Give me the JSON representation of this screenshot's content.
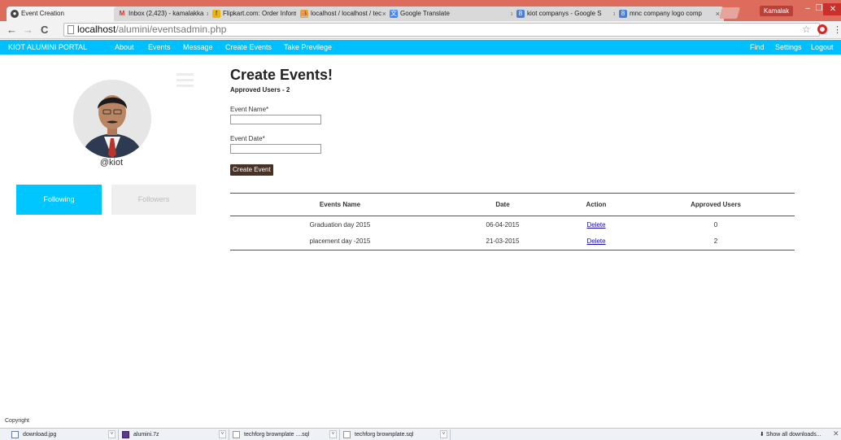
{
  "browser": {
    "tabs": [
      {
        "title": "Event Creation",
        "icon": "chrome-icon",
        "color": "#444444",
        "active": true
      },
      {
        "title": "Inbox (2,423) - kamalakka",
        "icon": "gmail-icon",
        "color": "#d93025",
        "active": false
      },
      {
        "title": "Flipkart.com: Order Inform",
        "icon": "flipkart-icon",
        "color": "#f0b400",
        "active": false
      },
      {
        "title": "localhost / localhost / tec",
        "icon": "phpmyadmin-icon",
        "color": "#e8a23a",
        "active": false
      },
      {
        "title": "Google Translate",
        "icon": "translate-icon",
        "color": "#4285f4",
        "active": false
      },
      {
        "title": "kiot companys - Google S",
        "icon": "google-icon",
        "color": "#4a7fd6",
        "active": false
      },
      {
        "title": "mnc company logo comp",
        "icon": "google-icon",
        "color": "#4a7fd6",
        "active": false
      }
    ],
    "user_name": "Kamalak",
    "window_controls": {
      "minimize": "–",
      "maximize": "❐",
      "close": "✕"
    },
    "url_host": "localhost",
    "url_path": "/alumini/eventsadmin.php"
  },
  "nav": {
    "brand": "KIOT ALUMINI PORTAL",
    "left_items": [
      "About",
      "Events",
      "Message",
      "Create Events",
      "Take Previlege"
    ],
    "right_items": [
      "Find",
      "Settings",
      "Logout"
    ]
  },
  "profile": {
    "username": "@kiot",
    "following_label": "Following",
    "followers_label": "Followers"
  },
  "main": {
    "title": "Create Events!",
    "approved_users": "Approved Users - 2",
    "form": {
      "event_name_label": "Event Name*",
      "event_name_value": "",
      "event_date_label": "Event Date*",
      "event_date_value": "",
      "submit_label": "Create Event"
    },
    "table": {
      "headers": [
        "Events Name",
        "Date",
        "Action",
        "Approved Users"
      ],
      "rows": [
        {
          "name": "Graduation day 2015",
          "date": "06-04-2015",
          "action": "Delete",
          "approved": "0"
        },
        {
          "name": "placement day -2015",
          "date": "21-03-2015",
          "action": "Delete",
          "approved": "2"
        }
      ]
    }
  },
  "footer": {
    "copyright": "Copyright"
  },
  "downloads": {
    "items": [
      {
        "name": "download.jpg",
        "icon": "image-file-icon"
      },
      {
        "name": "alumini.7z",
        "icon": "archive-file-icon"
      },
      {
        "name": "techforg brownplate ....sql",
        "icon": "document-file-icon"
      },
      {
        "name": "techforg brownplate.sql",
        "icon": "document-file-icon"
      }
    ],
    "show_all": "Show all downloads...",
    "close": "✕"
  }
}
